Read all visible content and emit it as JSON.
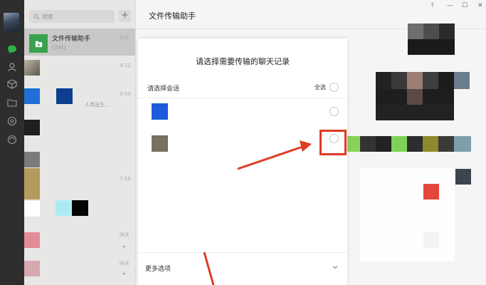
{
  "sidebar": {
    "icons": [
      "chat-icon",
      "contacts-icon",
      "box-icon",
      "folder-icon",
      "miniprogram-icon",
      "settings-icon"
    ]
  },
  "chatlist": {
    "search_placeholder": "搜索",
    "add_label": "+",
    "active_chat": {
      "name": "文件传输助手",
      "subtitle": "[文件]",
      "time": "昨天"
    },
    "timestamps": [
      "9:22",
      "9:04",
      "7:50",
      "昨天",
      "昨天",
      "昨天"
    ],
    "preview_text": "人类出生..."
  },
  "window": {
    "title": "文件传输助手",
    "controls": [
      "⫯",
      "—",
      "☐",
      "✕"
    ]
  },
  "dialog": {
    "title": "请选择需要传输的聊天记录",
    "subtitle": "请选择会话",
    "select_all": "全选",
    "more_options": "更多选项",
    "rows": [
      {
        "thumb_color": "#1e5bdc"
      },
      {
        "thumb_color": "#767060"
      }
    ]
  },
  "colors": {
    "accent_green": "#3aa14e",
    "highlight_red": "#e03a23",
    "rail_bg": "#2e2e2e"
  }
}
